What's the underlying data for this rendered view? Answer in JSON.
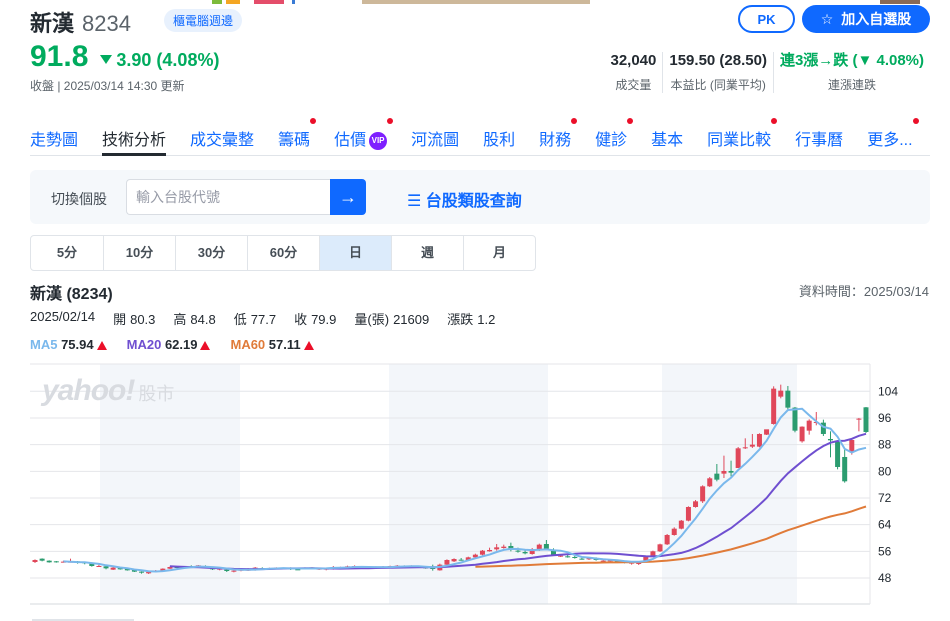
{
  "header": {
    "name": "新漢",
    "code": "8234",
    "badge": "櫃電腦週邊",
    "price": "91.8",
    "change": "3.90 (4.08%)",
    "change_direction": "down",
    "updated": "收盤 | 2025/03/14 14:30 更新",
    "pk_label": "PK",
    "add_watchlist_label": "加入自選股"
  },
  "stats": [
    {
      "value": "32,040",
      "label": "成交量"
    },
    {
      "value": "159.50 (28.50)",
      "label": "本益比 (同業平均)"
    },
    {
      "value": "連3漲→跌 (▼ 4.08%)",
      "label": "連漲連跌"
    }
  ],
  "tabs": [
    {
      "label": "走勢圖",
      "active": false,
      "dot": false
    },
    {
      "label": "技術分析",
      "active": true,
      "dot": false
    },
    {
      "label": "成交彙整",
      "active": false,
      "dot": false
    },
    {
      "label": "籌碼",
      "active": false,
      "dot": true
    },
    {
      "label": "估價",
      "active": false,
      "dot": true,
      "vip": "VIP"
    },
    {
      "label": "河流圖",
      "active": false,
      "dot": false
    },
    {
      "label": "股利",
      "active": false,
      "dot": false
    },
    {
      "label": "財務",
      "active": false,
      "dot": true
    },
    {
      "label": "健診",
      "active": false,
      "dot": true
    },
    {
      "label": "基本",
      "active": false,
      "dot": false
    },
    {
      "label": "同業比較",
      "active": false,
      "dot": true
    },
    {
      "label": "行事曆",
      "active": false,
      "dot": false
    },
    {
      "label": "更多...",
      "active": false,
      "dot": true
    }
  ],
  "search": {
    "label": "切換個股",
    "placeholder": "輸入台股代號",
    "value": "",
    "go_icon": "→",
    "category_link": "台股類股查詢"
  },
  "periods": [
    {
      "label": "5分",
      "active": false
    },
    {
      "label": "10分",
      "active": false
    },
    {
      "label": "30分",
      "active": false
    },
    {
      "label": "60分",
      "active": false
    },
    {
      "label": "日",
      "active": true
    },
    {
      "label": "週",
      "active": false
    },
    {
      "label": "月",
      "active": false
    }
  ],
  "chart_info": {
    "title": "新漢 (8234)",
    "data_time": "資料時間：2025/03/14",
    "date": "2025/02/14",
    "open_label": "開",
    "open": "80.3",
    "high_label": "高",
    "high": "84.8",
    "low_label": "低",
    "low": "77.7",
    "close_label": "收",
    "close": "79.9",
    "volume_label": "量(張)",
    "volume": "21609",
    "change_label": "漲跌",
    "change": "1.2",
    "ma": [
      {
        "label": "MA5",
        "value": "75.94",
        "color": "#7ab8ec"
      },
      {
        "label": "MA20",
        "value": "62.19",
        "color": "#6f4fd0"
      },
      {
        "label": "MA60",
        "value": "57.11",
        "color": "#e07b39"
      }
    ],
    "watermark": "yahoo!",
    "watermark_sub": "股市"
  },
  "colors": {
    "up": "#e0475a",
    "down": "#2b9c6f",
    "accent": "#0f69ff",
    "ma5": "#7ab8ec",
    "ma20": "#6f4fd0",
    "ma60": "#e07b39"
  },
  "chart_data": {
    "type": "candlestick",
    "title": "新漢 (8234) 日K",
    "y_ticks": [
      48,
      56,
      64,
      72,
      80,
      88,
      96,
      104
    ],
    "ylim": [
      42,
      112
    ],
    "grid": true,
    "candles": [
      [
        52.8,
        53.6,
        52.5,
        53.4
      ],
      [
        53.8,
        53.9,
        53.0,
        53.2
      ],
      [
        53.2,
        53.3,
        52.6,
        52.7
      ],
      [
        53.0,
        53.1,
        52.6,
        52.7
      ],
      [
        52.9,
        53.2,
        52.6,
        52.9
      ],
      [
        52.8,
        53.8,
        52.7,
        52.9
      ],
      [
        53.0,
        53.1,
        52.3,
        52.6
      ],
      [
        52.8,
        52.9,
        52.1,
        52.4
      ],
      [
        52.6,
        52.7,
        51.4,
        51.6
      ],
      [
        51.6,
        52.0,
        51.4,
        51.6
      ],
      [
        51.5,
        51.7,
        50.6,
        50.9
      ],
      [
        50.5,
        51.3,
        50.4,
        51.1
      ],
      [
        51.1,
        51.2,
        50.5,
        50.6
      ],
      [
        50.7,
        50.9,
        50.2,
        50.3
      ],
      [
        50.4,
        50.5,
        49.8,
        49.9
      ],
      [
        49.9,
        50.0,
        49.3,
        49.6
      ],
      [
        49.4,
        50.1,
        49.2,
        49.8
      ],
      [
        49.8,
        50.4,
        49.7,
        50.2
      ],
      [
        50.2,
        50.9,
        50.1,
        50.8
      ],
      [
        50.8,
        51.4,
        50.7,
        51.3
      ],
      [
        51.3,
        51.6,
        50.8,
        51.2
      ],
      [
        51.2,
        51.6,
        51.1,
        51.5
      ],
      [
        51.5,
        51.8,
        51.2,
        51.4
      ],
      [
        51.4,
        51.9,
        51.3,
        51.8
      ],
      [
        51.6,
        51.8,
        50.9,
        51.0
      ],
      [
        51.0,
        51.2,
        50.4,
        50.6
      ],
      [
        50.6,
        51.0,
        50.3,
        50.8
      ],
      [
        50.5,
        50.8,
        49.8,
        50.1
      ],
      [
        50.0,
        50.4,
        49.7,
        50.2
      ],
      [
        50.2,
        50.9,
        50.0,
        50.7
      ],
      [
        50.3,
        51.0,
        50.1,
        50.5
      ],
      [
        50.3,
        51.3,
        50.2,
        51.1
      ],
      [
        50.9,
        51.2,
        50.4,
        50.6
      ],
      [
        50.6,
        51.1,
        50.5,
        51.0
      ],
      [
        50.8,
        51.2,
        50.6,
        51.1
      ],
      [
        50.7,
        51.1,
        50.6,
        51.0
      ],
      [
        51.1,
        51.2,
        50.4,
        50.6
      ],
      [
        50.6,
        50.8,
        50.4,
        50.5
      ],
      [
        50.8,
        51.2,
        50.6,
        51.1
      ],
      [
        50.7,
        51.3,
        50.6,
        51.2
      ],
      [
        50.6,
        51.1,
        50.4,
        50.8
      ],
      [
        50.5,
        50.9,
        50.3,
        50.8
      ],
      [
        50.6,
        51.6,
        50.5,
        51.3
      ],
      [
        51.0,
        51.4,
        50.8,
        51.3
      ],
      [
        51.2,
        51.7,
        51.0,
        51.5
      ],
      [
        51.3,
        51.8,
        51.2,
        51.6
      ],
      [
        51.5,
        51.6,
        50.9,
        51.0
      ],
      [
        51.0,
        51.4,
        50.8,
        51.1
      ],
      [
        51.1,
        51.5,
        50.9,
        51.2
      ],
      [
        51.1,
        51.6,
        51.0,
        51.4
      ],
      [
        51.3,
        51.7,
        51.1,
        51.6
      ],
      [
        51.5,
        51.9,
        51.3,
        51.7
      ],
      [
        51.6,
        51.8,
        51.2,
        51.4
      ],
      [
        51.3,
        51.8,
        51.2,
        51.6
      ],
      [
        51.4,
        51.7,
        51.0,
        51.2
      ],
      [
        51.2,
        51.5,
        50.8,
        51.0
      ],
      [
        51.0,
        52.0,
        50.2,
        50.8
      ],
      [
        50.3,
        52.3,
        50.2,
        52.0
      ],
      [
        52.0,
        53.6,
        51.9,
        53.4
      ],
      [
        53.0,
        53.9,
        52.8,
        53.7
      ],
      [
        53.5,
        54.0,
        53.2,
        53.3
      ],
      [
        53.4,
        54.4,
        53.3,
        54.2
      ],
      [
        54.2,
        55.3,
        54.0,
        55.0
      ],
      [
        55.0,
        56.4,
        54.8,
        56.2
      ],
      [
        56.0,
        57.1,
        55.9,
        56.4
      ],
      [
        56.6,
        58.2,
        56.2,
        57.2
      ],
      [
        57.0,
        58.0,
        56.8,
        57.4
      ],
      [
        57.6,
        58.6,
        56.0,
        56.4
      ],
      [
        56.2,
        57.1,
        55.6,
        56.1
      ],
      [
        55.8,
        56.6,
        55.1,
        55.4
      ],
      [
        55.2,
        57.0,
        55.0,
        56.6
      ],
      [
        56.4,
        58.3,
        56.1,
        58.0
      ],
      [
        58.2,
        59.4,
        56.4,
        56.8
      ],
      [
        56.4,
        56.9,
        54.6,
        54.8
      ],
      [
        54.6,
        55.2,
        54.3,
        54.7
      ],
      [
        54.5,
        55.0,
        54.1,
        54.3
      ],
      [
        54.3,
        54.6,
        53.8,
        54.0
      ],
      [
        53.8,
        54.3,
        53.5,
        53.7
      ],
      [
        53.6,
        54.2,
        53.4,
        53.9
      ],
      [
        53.8,
        54.2,
        53.2,
        53.4
      ],
      [
        53.2,
        53.8,
        52.9,
        53.2
      ],
      [
        53.0,
        53.6,
        52.7,
        53.3
      ],
      [
        53.1,
        53.5,
        52.6,
        52.9
      ],
      [
        52.8,
        53.2,
        52.4,
        52.5
      ],
      [
        52.4,
        53.0,
        52.0,
        52.6
      ],
      [
        52.2,
        53.1,
        51.9,
        53.0
      ],
      [
        53.0,
        54.6,
        52.9,
        54.4
      ],
      [
        54.4,
        56.2,
        54.3,
        56.0
      ],
      [
        56.0,
        58.3,
        55.8,
        58.1
      ],
      [
        58.1,
        61.2,
        57.9,
        60.9
      ],
      [
        60.9,
        63.2,
        60.7,
        62.8
      ],
      [
        62.8,
        65.4,
        62.6,
        65.2
      ],
      [
        65.2,
        69.5,
        65.0,
        69.3
      ],
      [
        69.3,
        71.4,
        69.1,
        71.0
      ],
      [
        71.0,
        75.8,
        70.5,
        75.5
      ],
      [
        75.5,
        78.3,
        75.3,
        77.9
      ],
      [
        79.3,
        82.2,
        77.0,
        77.5
      ],
      [
        79.3,
        84.7,
        78.0,
        80.1
      ],
      [
        80.1,
        83.2,
        78.5,
        79.6
      ],
      [
        81.0,
        87.3,
        81.0,
        86.9
      ],
      [
        86.9,
        89.9,
        86.7,
        87.2
      ],
      [
        87.4,
        91.2,
        87.0,
        88.0
      ],
      [
        87.4,
        91.4,
        87.2,
        91.2
      ],
      [
        91.0,
        92.4,
        90.9,
        92.6
      ],
      [
        94.2,
        105.5,
        94.0,
        104.8
      ],
      [
        102.4,
        106.0,
        101.9,
        104.2
      ],
      [
        104.2,
        105.6,
        98.3,
        99.1
      ],
      [
        99.1,
        99.3,
        91.7,
        92.2
      ],
      [
        89.0,
        93.5,
        88.6,
        93.4
      ],
      [
        92.2,
        95.6,
        91.0,
        95.2
      ],
      [
        94.7,
        97.8,
        93.8,
        94.8
      ],
      [
        94.6,
        95.5,
        90.6,
        91.2
      ],
      [
        89.7,
        92.0,
        84.2,
        89.3
      ],
      [
        89.0,
        89.2,
        80.6,
        81.3
      ],
      [
        84.3,
        86.5,
        76.6,
        77.0
      ],
      [
        85.7,
        90.0,
        85.0,
        89.4
      ],
      [
        95.7,
        96.0,
        92.0,
        95.8
      ],
      [
        99.2,
        99.3,
        91.5,
        91.8
      ]
    ]
  }
}
